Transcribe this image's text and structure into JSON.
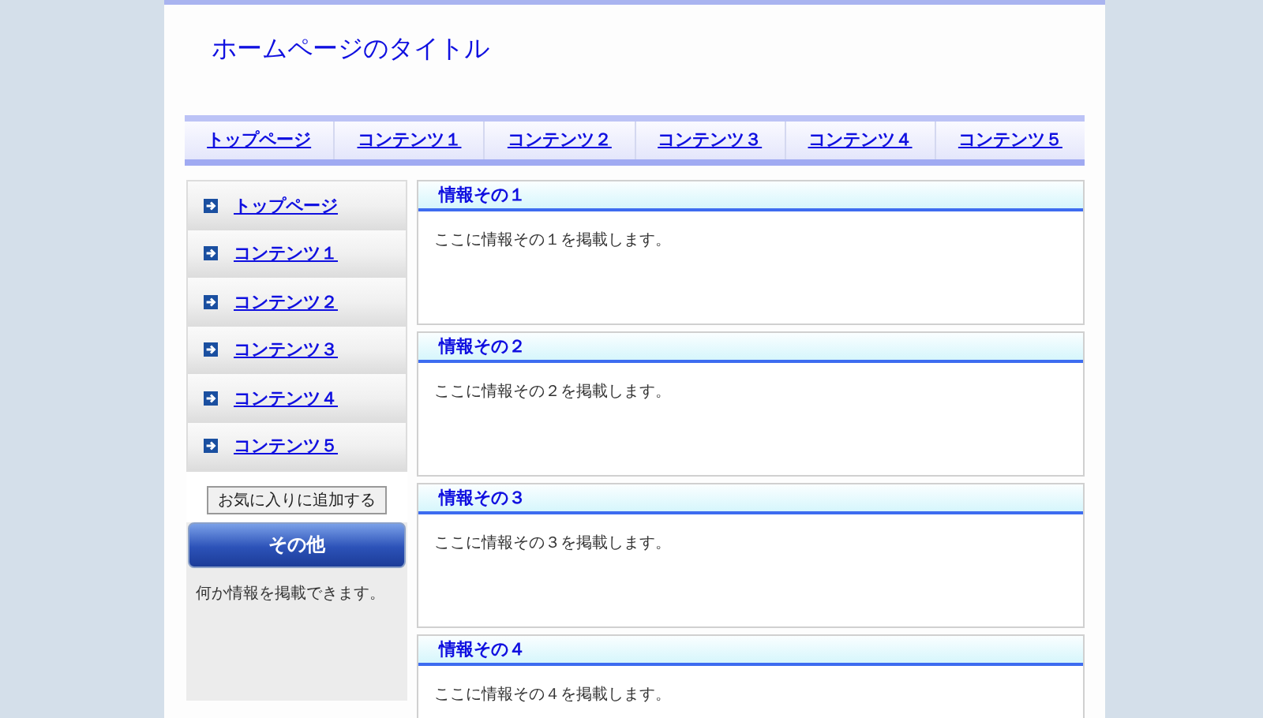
{
  "site_title": "ホームページのタイトル",
  "nav": [
    {
      "label": "トップページ"
    },
    {
      "label": "コンテンツ１"
    },
    {
      "label": "コンテンツ２"
    },
    {
      "label": "コンテンツ３"
    },
    {
      "label": "コンテンツ４"
    },
    {
      "label": "コンテンツ５"
    }
  ],
  "sidebar": {
    "items": [
      {
        "label": "トップページ"
      },
      {
        "label": "コンテンツ１"
      },
      {
        "label": "コンテンツ２"
      },
      {
        "label": "コンテンツ３"
      },
      {
        "label": "コンテンツ４"
      },
      {
        "label": "コンテンツ５"
      }
    ],
    "bookmark_button": "お気に入りに追加する",
    "other": {
      "title": "その他",
      "text": "何か情報を掲載できます。"
    }
  },
  "sections": [
    {
      "title": "情報その１",
      "text": "ここに情報その１を掲載します。"
    },
    {
      "title": "情報その２",
      "text": "ここに情報その２を掲載します。"
    },
    {
      "title": "情報その３",
      "text": "ここに情報その３を掲載します。"
    },
    {
      "title": "情報その４",
      "text": "ここに情報その４を掲載します。"
    }
  ]
}
